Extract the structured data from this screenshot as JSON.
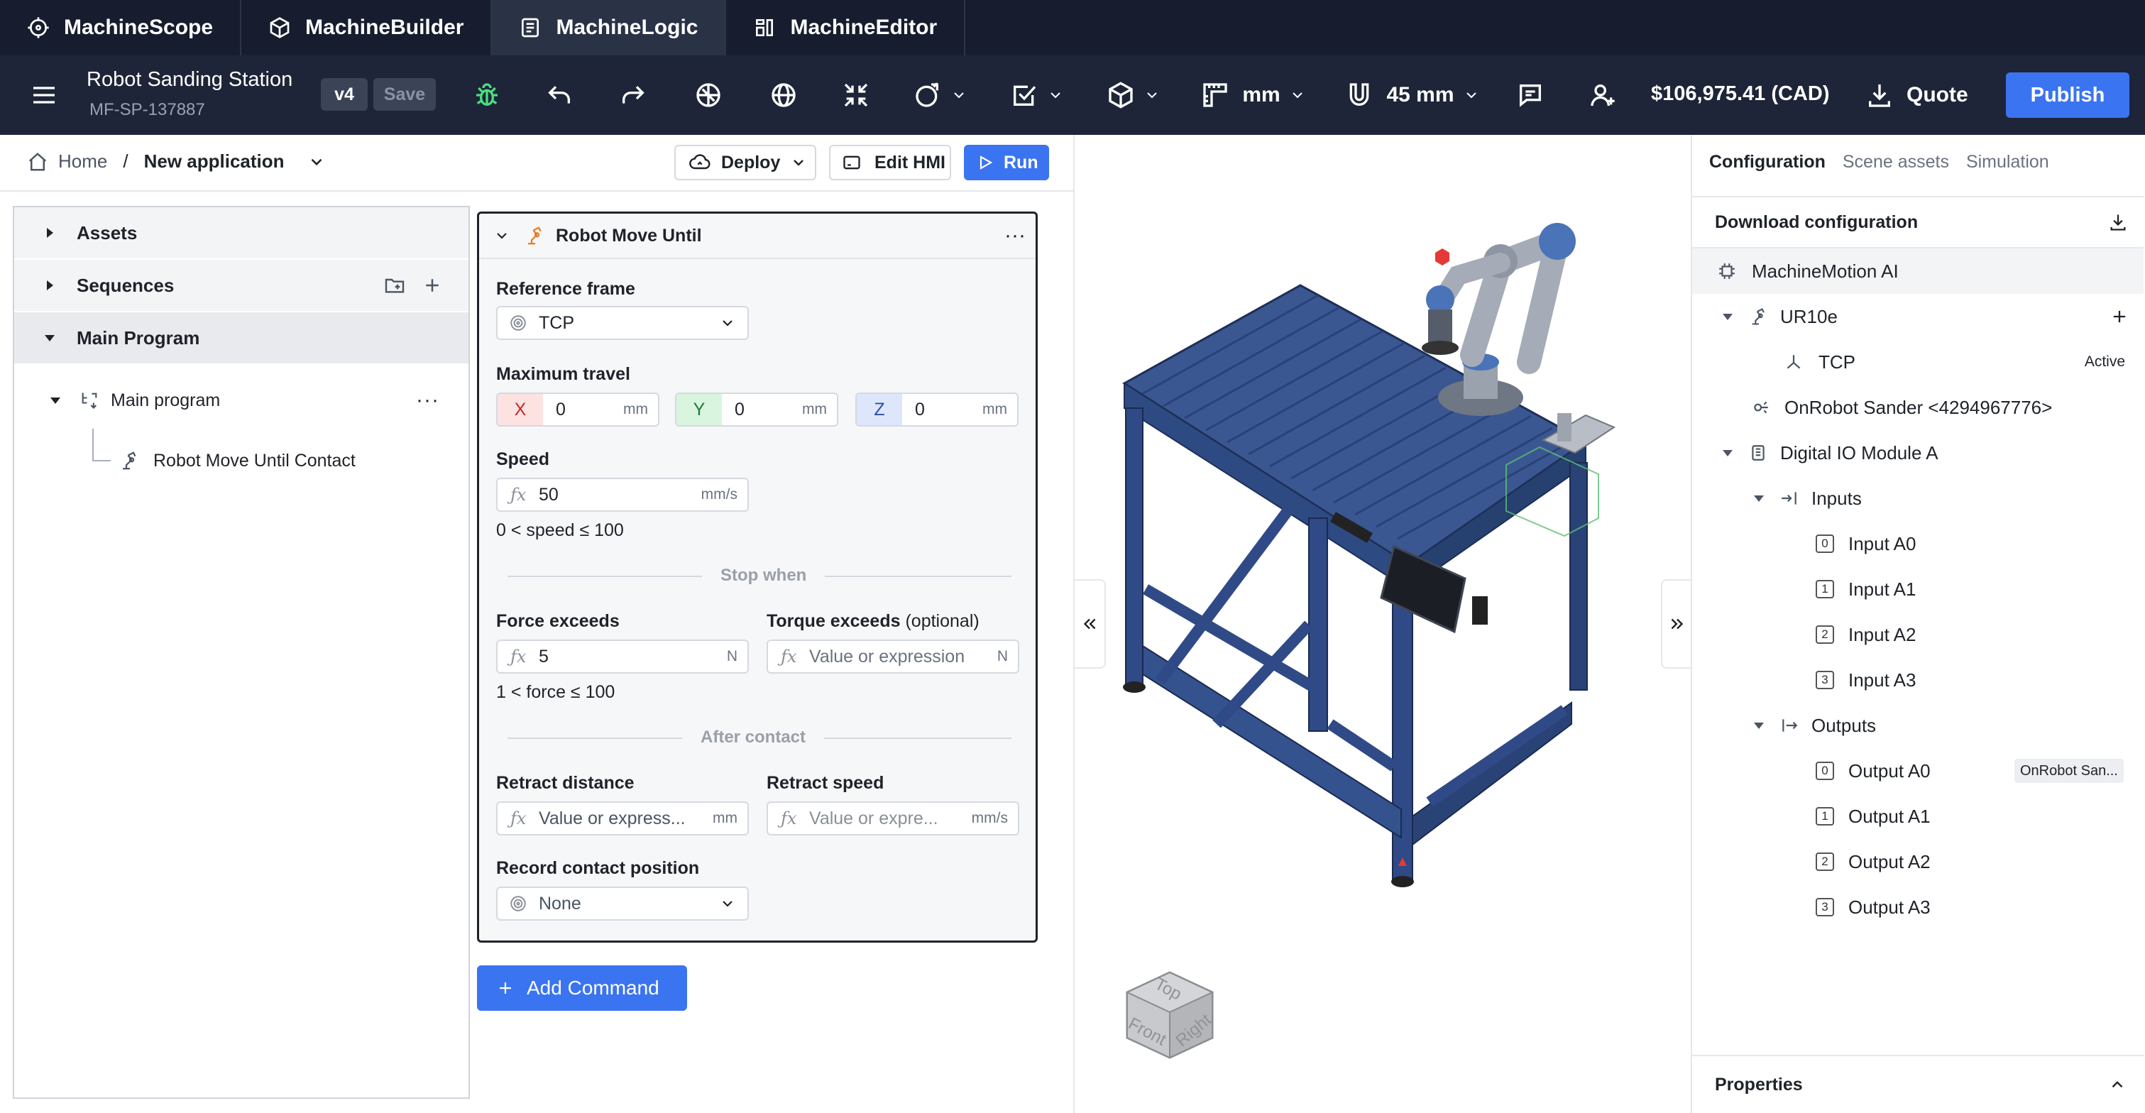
{
  "app_tabs": [
    {
      "label": "MachineScope",
      "icon": "target-icon"
    },
    {
      "label": "MachineBuilder",
      "icon": "cube-icon"
    },
    {
      "label": "MachineLogic",
      "icon": "document-icon"
    },
    {
      "label": "MachineEditor",
      "icon": "editor-icon"
    }
  ],
  "toolbar": {
    "project_title": "Robot Sanding Station",
    "project_id": "MF-SP-137887",
    "version": "v4",
    "save_label": "Save",
    "units": "mm",
    "snap": "45 mm",
    "price": "$106,975.41 (CAD)",
    "quote_label": "Quote",
    "publish_label": "Publish"
  },
  "breadcrumb": {
    "home": "Home",
    "separator": "/",
    "current": "New application"
  },
  "actions": {
    "deploy": "Deploy",
    "edit_hmi": "Edit HMI",
    "run": "Run"
  },
  "left_panel": {
    "assets": "Assets",
    "sequences": "Sequences",
    "main_program": "Main Program",
    "program_item": "Main program",
    "command_item": "Robot Move Until Contact"
  },
  "card": {
    "title": "Robot Move Until",
    "reference_frame_label": "Reference frame",
    "reference_frame_value": "TCP",
    "max_travel_label": "Maximum travel",
    "x_axis": "X",
    "x_value": "0",
    "y_axis": "Y",
    "y_value": "0",
    "z_axis": "Z",
    "z_value": "0",
    "unit_mm": "mm",
    "speed_label": "Speed",
    "speed_value": "50",
    "speed_unit": "mm/s",
    "speed_hint": "0 < speed ≤ 100",
    "stop_when": "Stop when",
    "force_label": "Force exceeds",
    "force_value": "5",
    "force_unit": "N",
    "force_hint": "1 < force ≤ 100",
    "torque_label": "Torque exceeds",
    "torque_optional": "(optional)",
    "torque_placeholder": "Value or expression",
    "torque_unit": "N",
    "after_contact": "After contact",
    "retract_distance_label": "Retract distance",
    "retract_distance_placeholder": "Value or express...",
    "retract_distance_unit": "mm",
    "retract_speed_label": "Retract speed",
    "retract_speed_placeholder": "Value or expre...",
    "retract_speed_unit": "mm/s",
    "record_label": "Record contact position",
    "record_value": "None"
  },
  "add_command": "Add Command",
  "view_cube": {
    "top": "Top",
    "front": "Front",
    "right": "Right"
  },
  "right_panel": {
    "tabs": [
      "Configuration",
      "Scene assets",
      "Simulation"
    ],
    "download": "Download configuration",
    "tree": {
      "controller": "MachineMotion AI",
      "robot": "UR10e",
      "tcp": "TCP",
      "tcp_status": "Active",
      "sander": "OnRobot Sander <4294967776>",
      "io_module": "Digital IO Module A",
      "inputs": "Inputs",
      "input_items": [
        {
          "index": "0",
          "label": "Input A0"
        },
        {
          "index": "1",
          "label": "Input A1"
        },
        {
          "index": "2",
          "label": "Input A2"
        },
        {
          "index": "3",
          "label": "Input A3"
        }
      ],
      "outputs": "Outputs",
      "output_items": [
        {
          "index": "0",
          "label": "Output A0",
          "badge": "OnRobot San..."
        },
        {
          "index": "1",
          "label": "Output A1"
        },
        {
          "index": "2",
          "label": "Output A2"
        },
        {
          "index": "3",
          "label": "Output A3"
        }
      ]
    },
    "properties": "Properties"
  },
  "colors": {
    "nav_bg": "#171d2e",
    "toolbar_bg": "#1e2538",
    "accent": "#3b74f0",
    "debug_green": "#4ade80",
    "frame_blue": "#2f4a86"
  }
}
